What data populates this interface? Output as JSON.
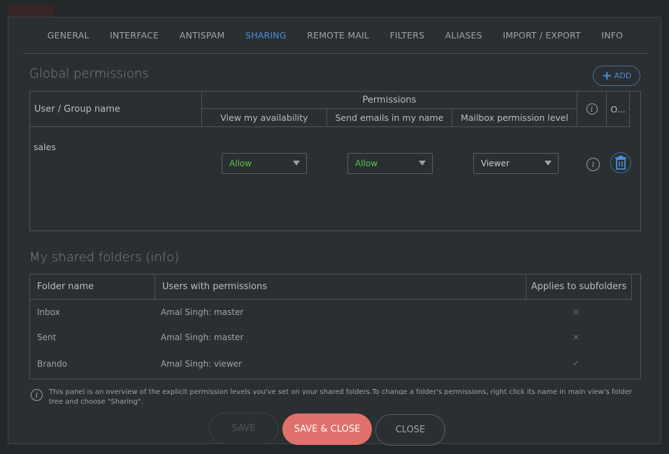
{
  "tabs": [
    {
      "label": "GENERAL",
      "active": false
    },
    {
      "label": "INTERFACE",
      "active": false
    },
    {
      "label": "ANTISPAM",
      "active": false
    },
    {
      "label": "SHARING",
      "active": true
    },
    {
      "label": "REMOTE MAIL",
      "active": false
    },
    {
      "label": "FILTERS",
      "active": false
    },
    {
      "label": "ALIASES",
      "active": false
    },
    {
      "label": "IMPORT / EXPORT",
      "active": false
    },
    {
      "label": "INFO",
      "active": false
    }
  ],
  "global_permissions": {
    "title": "Global permissions",
    "add_label": "ADD",
    "headers": {
      "user": "User / Group name",
      "permissions": "Permissions",
      "view_availability": "View my availability",
      "send_emails": "Send emails in my name",
      "mailbox_level": "Mailbox permission level",
      "other": "O..."
    },
    "rows": [
      {
        "user": "sales",
        "view_availability": "Allow",
        "send_emails": "Allow",
        "mailbox_level": "Viewer"
      }
    ]
  },
  "shared_folders": {
    "title": "My shared folders (info)",
    "headers": {
      "folder": "Folder name",
      "users": "Users with permissions",
      "subfolders": "Applies to subfolders"
    },
    "rows": [
      {
        "folder": "Inbox",
        "users": "Amal Singh: master",
        "subfolders": "✕"
      },
      {
        "folder": "Sent",
        "users": "Amal Singh: master",
        "subfolders": "✕"
      },
      {
        "folder": "Brando",
        "users": "Amal Singh: viewer",
        "subfolders": "✓"
      }
    ]
  },
  "note": "This panel is an overview of the explicit permission levels you've set on your shared folders.To change a folder's permissions, right click its name in main view's folder tree and choose \"Sharing\".",
  "buttons": {
    "save": "SAVE",
    "save_close": "SAVE & CLOSE",
    "close": "CLOSE"
  },
  "icons": {
    "info": "i",
    "add": "+"
  },
  "colors": {
    "accent": "#4a90d9",
    "allow": "#5ec44a",
    "primary_button": "#e0706b"
  }
}
